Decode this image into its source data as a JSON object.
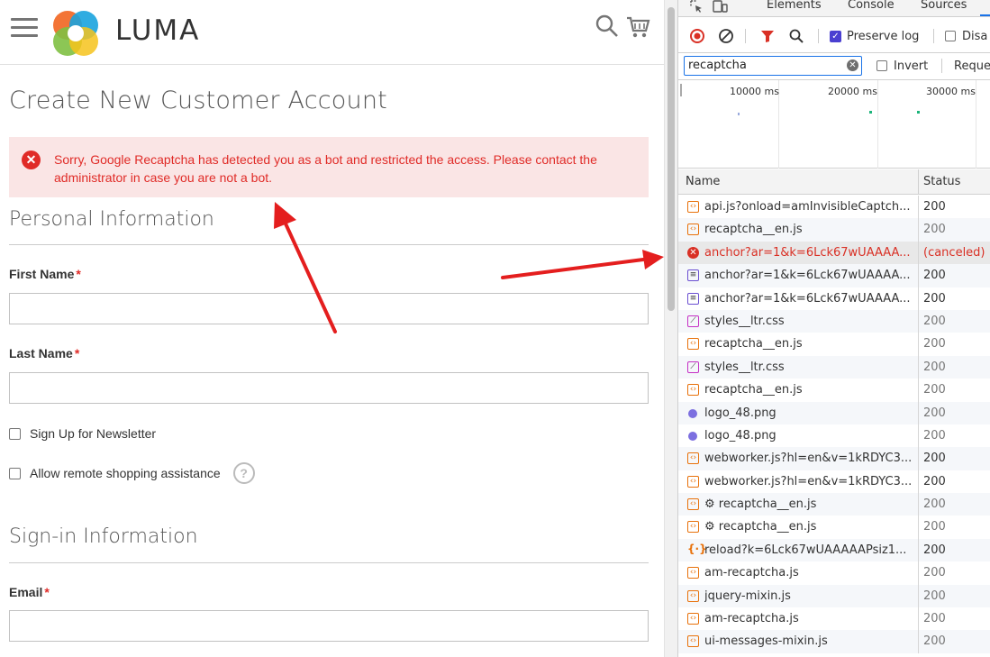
{
  "shop": {
    "logo_text": "LUMA",
    "page_title": "Create New Customer Account",
    "error_message": "Sorry, Google Recaptcha has detected you as a bot and restricted the access. Please contact the administrator in case you are not a bot.",
    "error_icon_glyph": "✕",
    "personal_info_title": "Personal Information",
    "first_name_label": "First Name",
    "last_name_label": "Last Name",
    "required_mark": "*",
    "newsletter_label": "Sign Up for Newsletter",
    "remote_assist_label": "Allow remote shopping assistance",
    "help_glyph": "?",
    "signin_info_title": "Sign-in Information",
    "email_label": "Email",
    "first_name_value": "",
    "last_name_value": "",
    "email_value": ""
  },
  "devtools": {
    "tabs": [
      "Elements",
      "Console",
      "Sources"
    ],
    "preserve_log_label": "Preserve log",
    "disable_cache_label": "Disa",
    "filter_value": "recaptcha",
    "invert_label": "Invert",
    "request_types_label": "Reque",
    "timeline_labels": [
      "10000 ms",
      "20000 ms",
      "30000 ms"
    ],
    "columns": {
      "name": "Name",
      "status": "Status"
    },
    "rows": [
      {
        "name": "api.js?onload=amInvisibleCaptch...",
        "status": "200",
        "type": "script",
        "status_dim": false
      },
      {
        "name": "recaptcha__en.js",
        "status": "200",
        "type": "script",
        "status_dim": true
      },
      {
        "name": "anchor?ar=1&k=6Lck67wUAAAA...",
        "status": "(canceled)",
        "type": "error",
        "status_dim": false
      },
      {
        "name": "anchor?ar=1&k=6Lck67wUAAAA...",
        "status": "200",
        "type": "doc",
        "status_dim": false
      },
      {
        "name": "anchor?ar=1&k=6Lck67wUAAAA...",
        "status": "200",
        "type": "doc",
        "status_dim": false
      },
      {
        "name": "styles__ltr.css",
        "status": "200",
        "type": "style",
        "status_dim": true
      },
      {
        "name": "recaptcha__en.js",
        "status": "200",
        "type": "script",
        "status_dim": true
      },
      {
        "name": "styles__ltr.css",
        "status": "200",
        "type": "style",
        "status_dim": true
      },
      {
        "name": "recaptcha__en.js",
        "status": "200",
        "type": "script",
        "status_dim": true
      },
      {
        "name": "logo_48.png",
        "status": "200",
        "type": "img",
        "status_dim": true
      },
      {
        "name": "logo_48.png",
        "status": "200",
        "type": "img",
        "status_dim": true
      },
      {
        "name": "webworker.js?hl=en&v=1kRDYC3...",
        "status": "200",
        "type": "script",
        "status_dim": false
      },
      {
        "name": "webworker.js?hl=en&v=1kRDYC3...",
        "status": "200",
        "type": "script",
        "status_dim": false
      },
      {
        "name": "⚙ recaptcha__en.js",
        "status": "200",
        "type": "script",
        "status_dim": true
      },
      {
        "name": "⚙ recaptcha__en.js",
        "status": "200",
        "type": "script",
        "status_dim": true
      },
      {
        "name": "reload?k=6Lck67wUAAAAAPsiz1...",
        "status": "200",
        "type": "fetch",
        "status_dim": false
      },
      {
        "name": "am-recaptcha.js",
        "status": "200",
        "type": "script",
        "status_dim": true
      },
      {
        "name": "jquery-mixin.js",
        "status": "200",
        "type": "script",
        "status_dim": true
      },
      {
        "name": "am-recaptcha.js",
        "status": "200",
        "type": "script",
        "status_dim": true
      },
      {
        "name": "ui-messages-mixin.js",
        "status": "200",
        "type": "script",
        "status_dim": true
      }
    ]
  },
  "colors": {
    "error_red": "#e02b27",
    "error_bg": "#fae5e5",
    "annotation_arrow": "#e41e1e",
    "devtools_accent": "#1a73e8"
  }
}
